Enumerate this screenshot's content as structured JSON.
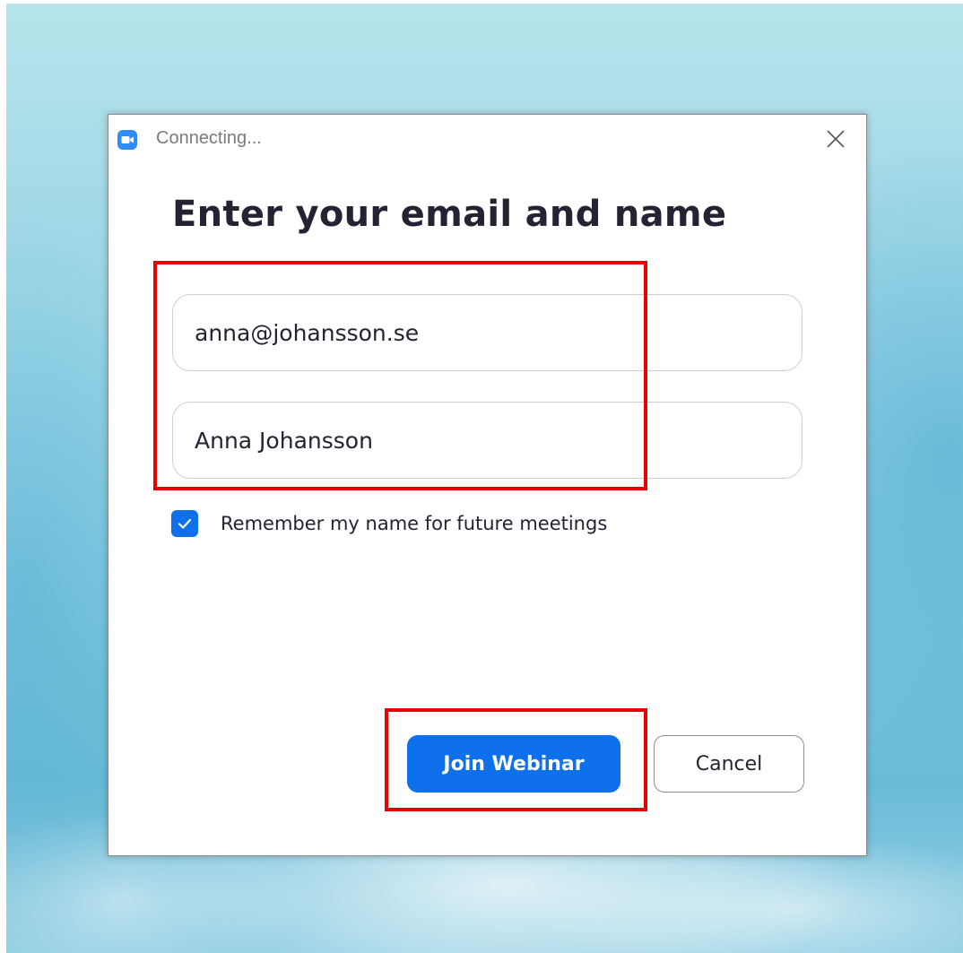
{
  "window": {
    "title": "Connecting...",
    "app_icon": "zoom-camera-icon",
    "close_icon": "close-icon"
  },
  "form": {
    "heading": "Enter your email and name",
    "email_value": "anna@johansson.se",
    "name_value": "Anna Johansson",
    "remember_checked": true,
    "remember_label": "Remember my name for future meetings"
  },
  "buttons": {
    "join_label": "Join Webinar",
    "cancel_label": "Cancel"
  },
  "colors": {
    "accent": "#0e71eb",
    "highlight": "#e80000",
    "heading_text": "#232333"
  }
}
